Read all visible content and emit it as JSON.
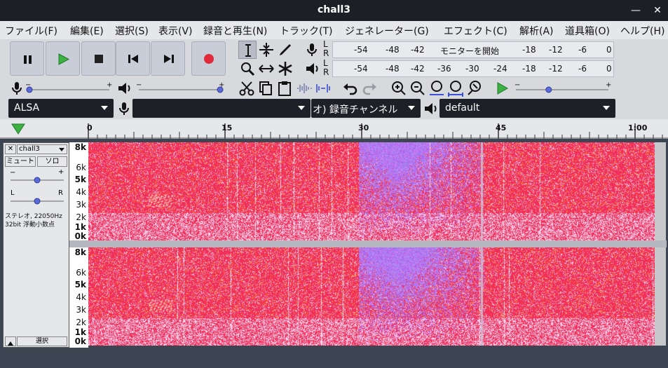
{
  "window": {
    "title": "chall3",
    "minimize": "—",
    "close": "✕"
  },
  "menu": [
    "ファイル(F)",
    "編集(E)",
    "選択(S)",
    "表示(V)",
    "録音と再生(N)",
    "トラック(T)",
    "ジェネレーター(G)",
    "エフェクト(C)",
    "解析(A)",
    "道具箱(O)",
    "ヘルプ(H)"
  ],
  "meters": {
    "record_channels": [
      "L",
      "R"
    ],
    "play_channels": [
      "L",
      "R"
    ],
    "record_scale": [
      "-54",
      "-48",
      "-42",
      "モニターを開始",
      "-18",
      "-12",
      "-6",
      "0"
    ],
    "play_scale": [
      "-54",
      "-48",
      "-42",
      "-36",
      "-30",
      "-24",
      "-18",
      "-12",
      "-6",
      "0"
    ]
  },
  "devices": {
    "host": "ALSA",
    "record_device": "",
    "channels": "オ) 録音チャンネル",
    "playback_device": "default"
  },
  "sliders": {
    "record_volume": 0.0,
    "playback_volume": 1.0,
    "play_speed": 0.5,
    "gain": 0.5,
    "pan": 0.5
  },
  "ruler_labels": [
    "0",
    "15",
    "30",
    "45",
    "1:00"
  ],
  "track": {
    "name": "chall3",
    "mute": "ミュート",
    "solo": "ソロ",
    "gain_minus": "−",
    "gain_plus": "+",
    "pan_left": "L",
    "pan_right": "R",
    "info_line1": "ステレオ, 22050Hz",
    "info_line2": "32bit 浮動小数点",
    "select": "選択",
    "close": "✕"
  },
  "freq_labels": [
    "8k",
    "6k",
    "5k",
    "4k",
    "3k",
    "2k",
    "1k",
    "0k"
  ],
  "colors": {
    "spectrogram_base": "#f0305a",
    "spectrogram_cool": "#8c5af0",
    "record": "#e02a3a",
    "play": "#3cb043"
  }
}
